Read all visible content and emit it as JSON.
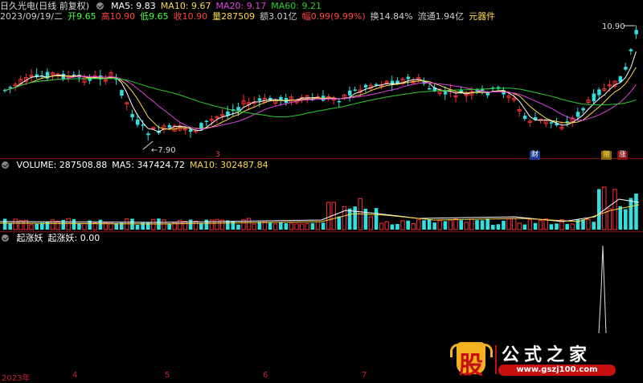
{
  "header": {
    "name": "日久光电(日线 前复权)",
    "ma_labels": [
      {
        "text": "MA5: 9.83",
        "color": "#ffffff"
      },
      {
        "text": "MA10: 9.67",
        "color": "#ffd84a"
      },
      {
        "text": "MA20: 9.17",
        "color": "#e040e0"
      },
      {
        "text": "MA60: 9.21",
        "color": "#28d028"
      }
    ]
  },
  "quote": [
    {
      "text": "2023/09/19/二",
      "color": "#cccccc"
    },
    {
      "text": "开9.65",
      "color": "#44ff44"
    },
    {
      "text": "高10.90",
      "color": "#ff4444"
    },
    {
      "text": "低9.65",
      "color": "#44ff44"
    },
    {
      "text": "收10.90",
      "color": "#ff4444"
    },
    {
      "text": "量287509",
      "color": "#ffd84a"
    },
    {
      "text": "额3.01亿",
      "color": "#cccccc"
    },
    {
      "text": "幅0.99(9.99%)",
      "color": "#ff4444"
    },
    {
      "text": "换14.84%",
      "color": "#cccccc"
    },
    {
      "text": "流通1.94亿",
      "color": "#cccccc"
    },
    {
      "text": "元器件",
      "color": "#ffd84a"
    }
  ],
  "volume_header": [
    {
      "text": "VOLUME: 287508.88",
      "color": "#ffffff"
    },
    {
      "text": "MA5: 347424.72",
      "color": "#ffffff"
    },
    {
      "text": "MA10: 302487.84",
      "color": "#ffd84a"
    }
  ],
  "indicator_header": [
    {
      "text": "起涨妖",
      "color": "#ffffff"
    },
    {
      "text": "起涨妖: 0.00",
      "color": "#ffffff"
    }
  ],
  "annotations": {
    "high_label": "10.90",
    "low_label": "7.90",
    "badge_cai": "财",
    "badge_zhu": "赠",
    "badge_zhang": "涨",
    "marker_a": "3"
  },
  "xaxis": {
    "year": "2023年",
    "months": [
      "4",
      "5",
      "6",
      "7"
    ]
  },
  "logo": {
    "left": "股",
    "right": "公式之家",
    "url": "www.gszj100.com"
  },
  "chart_data": {
    "type": "candlestick",
    "title": "",
    "price_range": [
      7.6,
      11.1
    ],
    "high": 10.9,
    "low": 7.9,
    "indicator": "起涨妖",
    "indicator_value": 0.0
  }
}
